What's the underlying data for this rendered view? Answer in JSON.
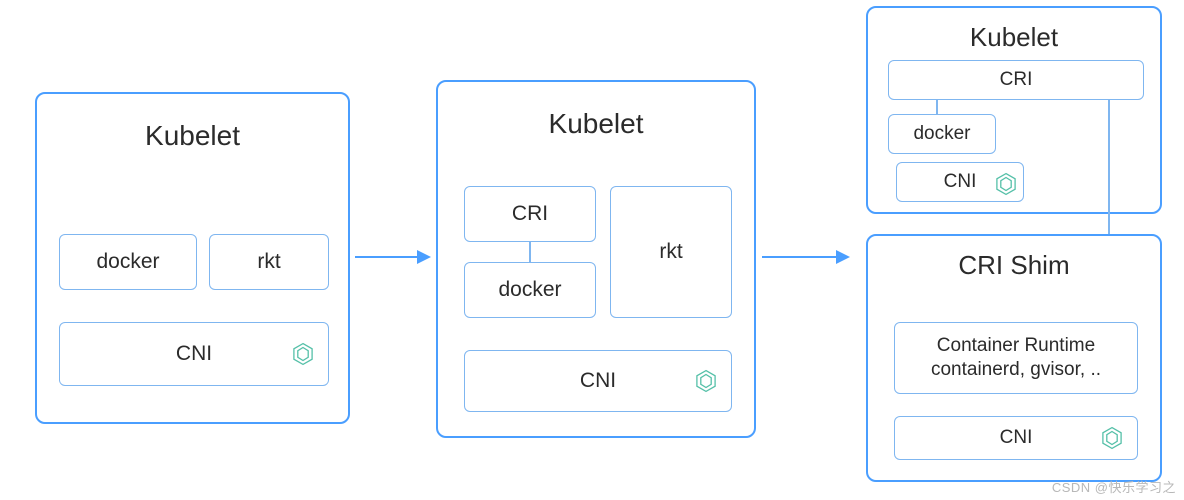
{
  "chart_data": {
    "type": "diagram",
    "title": "Kubelet CRI evolution",
    "stages": [
      {
        "id": 1,
        "container": "Kubelet",
        "children": [
          {
            "label": "docker"
          },
          {
            "label": "rkt"
          },
          {
            "label": "CNI",
            "icon": "cni"
          }
        ]
      },
      {
        "id": 2,
        "container": "Kubelet",
        "children": [
          {
            "label": "CRI",
            "children": [
              {
                "label": "docker"
              }
            ]
          },
          {
            "label": "rkt"
          },
          {
            "label": "CNI",
            "icon": "cni"
          }
        ]
      },
      {
        "id": 3,
        "containers": [
          {
            "name": "Kubelet",
            "children": [
              {
                "label": "CRI",
                "children": [
                  {
                    "label": "docker",
                    "children": [
                      {
                        "label": "CNI",
                        "icon": "cni"
                      }
                    ]
                  }
                ]
              }
            ]
          },
          {
            "name": "CRI Shim",
            "children": [
              {
                "label": "Container Runtime containerd, gvisor, .."
              },
              {
                "label": "CNI",
                "icon": "cni"
              }
            ]
          }
        ],
        "connects": "Kubelet.CRI -> CRI Shim (vertical)"
      }
    ],
    "arrows": [
      "stage1 -> stage2",
      "stage2 -> stage3"
    ]
  },
  "labels": {
    "stage1_title": "Kubelet",
    "stage1_docker": "docker",
    "stage1_rkt": "rkt",
    "stage1_cni": "CNI",
    "stage2_title": "Kubelet",
    "stage2_cri": "CRI",
    "stage2_docker": "docker",
    "stage2_rkt": "rkt",
    "stage2_cni": "CNI",
    "stage3a_title": "Kubelet",
    "stage3a_cri": "CRI",
    "stage3a_docker": "docker",
    "stage3a_cni": "CNI",
    "stage3b_title": "CRI Shim",
    "stage3b_runtime": "Container Runtime containerd, gvisor, ..",
    "stage3b_cni": "CNI"
  },
  "watermark": "CSDN @快乐学习之"
}
